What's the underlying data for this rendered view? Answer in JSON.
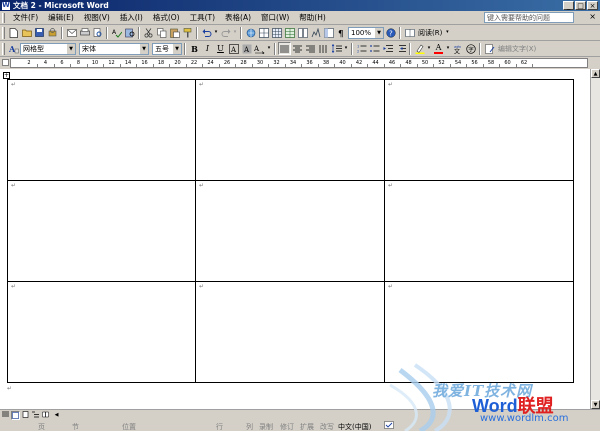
{
  "window": {
    "title": "文档 2 - Microsoft Word",
    "app_icon": "W",
    "buttons": {
      "minimize": "_",
      "maximize": "□",
      "close": "×"
    }
  },
  "menubar": {
    "items": [
      "文件(F)",
      "编辑(E)",
      "视图(V)",
      "插入(I)",
      "格式(O)",
      "工具(T)",
      "表格(A)",
      "窗口(W)",
      "帮助(H)"
    ],
    "help_placeholder": "键入需要帮助的问题",
    "close_glyph": "×"
  },
  "toolbar_standard": {
    "zoom": "100%",
    "read_label": "阅读(R)"
  },
  "toolbar_format": {
    "style": "网格型",
    "font": "宋体",
    "size": "五号",
    "bold": "B",
    "italic": "I",
    "underline": "U",
    "highlight": "A",
    "font_color": "A",
    "edit_text_label": "编辑文字(X)"
  },
  "ruler": {
    "ticks": [
      "2",
      "4",
      "6",
      "8",
      "10",
      "12",
      "14",
      "16",
      "18",
      "20",
      "22",
      "24",
      "26",
      "28",
      "30",
      "32",
      "34",
      "36",
      "38",
      "40",
      "42",
      "44",
      "46",
      "48",
      "50",
      "52",
      "54",
      "56",
      "58",
      "60",
      "62"
    ]
  },
  "table": {
    "rows": 3,
    "cols": 3,
    "cell_mark": "↵"
  },
  "document": {
    "trailing_mark": "↵",
    "move_handle_glyph": "+"
  },
  "statusbar": {
    "page": "页",
    "section": "节",
    "position": "位置",
    "line": "行",
    "column": "列",
    "rec": "录制",
    "trk": "修订",
    "ext": "扩展",
    "ovr": "改写",
    "language": "中文(中国)"
  },
  "watermark": {
    "tagline": "我爱IT技术网",
    "brand_word": "Word",
    "brand_cn": "联盟",
    "url": "www.wordlm.com"
  },
  "colors": {
    "titlebar_start": "#0a246a",
    "titlebar_end": "#3a6ea5",
    "chrome": "#d4d0c8",
    "watermark_blue": "#1f5fd6",
    "watermark_red": "#e02020"
  }
}
